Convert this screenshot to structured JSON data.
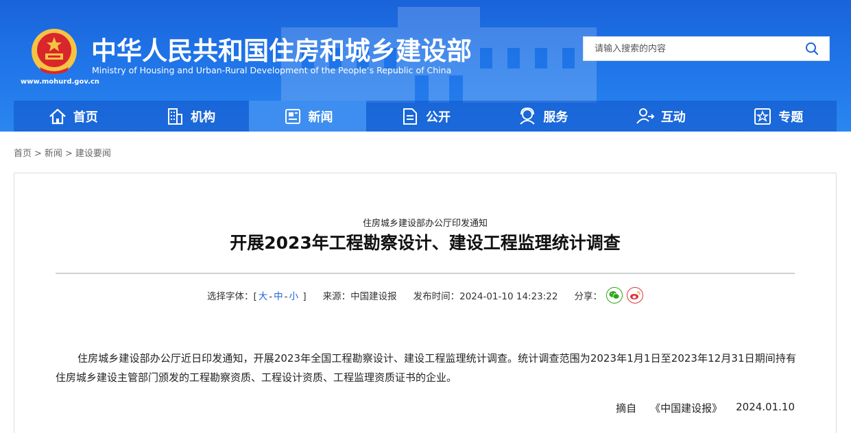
{
  "header": {
    "title_cn": "中华人民共和国住房和城乡建设部",
    "title_en": "Ministry of Housing and Urban-Rural Development of the People’s Republic of China",
    "domain": "www.mohurd.gov.cn",
    "emblem_icon": "national-emblem-icon",
    "search": {
      "placeholder": "请输入搜索的内容",
      "icon": "search-icon"
    }
  },
  "nav": {
    "items": [
      {
        "label": "首页",
        "icon": "home-icon"
      },
      {
        "label": "机构",
        "icon": "building-icon"
      },
      {
        "label": "新闻",
        "icon": "news-icon",
        "active": true
      },
      {
        "label": "公开",
        "icon": "document-icon"
      },
      {
        "label": "服务",
        "icon": "service-icon"
      },
      {
        "label": "互动",
        "icon": "interact-icon"
      },
      {
        "label": "专题",
        "icon": "star-icon"
      }
    ]
  },
  "breadcrumb": {
    "items": [
      "首页",
      "新闻",
      "建设要闻"
    ],
    "separator": ">"
  },
  "article": {
    "subtitle": "住房城乡建设部办公厅印发通知",
    "title": "开展2023年工程勘察设计、建设工程监理统计调查",
    "meta": {
      "font_label": "选择字体：[",
      "font_large": "大",
      "font_medium": "中",
      "font_small": "小",
      "font_close": "]",
      "font_dash": "-",
      "source_label": "来源：中国建设报",
      "published": "发布时间：2024-01-10 14:23:22",
      "share_label": "分享："
    },
    "body": "住房城乡建设部办公厅近日印发通知，开展2023年全国工程勘察设计、建设工程监理统计调查。统计调查范围为2023年1月1日至2023年12月31日期间持有住房城乡建设主管部门颁发的工程勘察资质、工程设计资质、工程监理资质证书的企业。",
    "excerpt_label": "摘自",
    "excerpt_source": "《中国建设报》",
    "excerpt_date": "2024.01.10"
  },
  "colors": {
    "brand_blue": "#1f74e8",
    "nav_active": "#3d8ef0",
    "link_blue": "#1a63d9"
  }
}
